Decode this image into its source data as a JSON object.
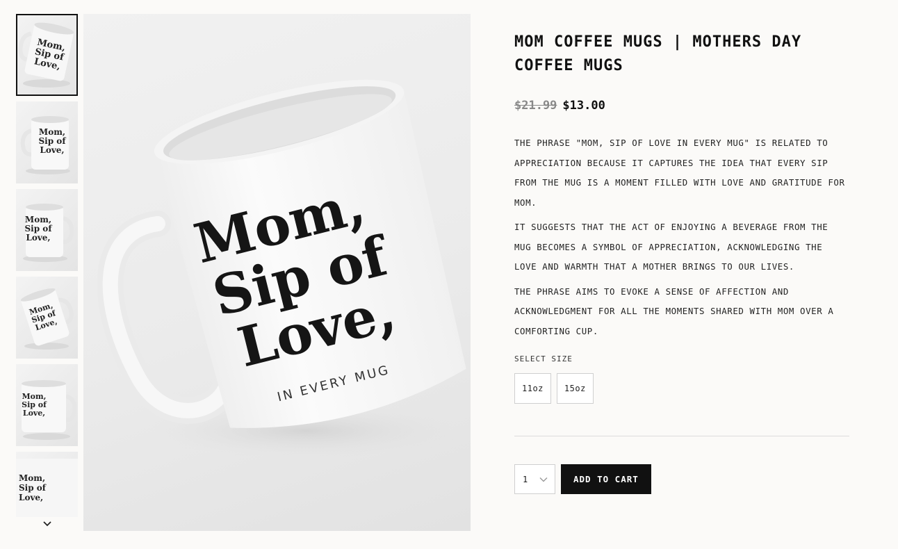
{
  "product": {
    "title": "Mom Coffee Mugs | Mothers Day Coffee Mugs",
    "price_original": "$21.99",
    "price_sale": "$13.00",
    "description": [
      "The phrase \"Mom, Sip of Love in Every Mug\" is related to appreciation because it captures the idea that every sip from the mug is a moment filled with love and gratitude for Mom.",
      "It suggests that the act of enjoying a beverage from the mug becomes a symbol of appreciation, acknowledging the love and warmth that a mother brings to our lives.",
      "The phrase aims to evoke a sense of affection and acknowledgment for all the moments shared with Mom over a comforting cup."
    ]
  },
  "mug_print": {
    "line1": "Mom,",
    "line2": "Sip of",
    "line3": "Love,",
    "tagline": "IN EVERY MUG"
  },
  "gallery": {
    "selected_index": 0,
    "thumbnail_count": 6,
    "scroll_icon": "chevron-down-icon"
  },
  "size_selector": {
    "label": "Select Size",
    "options": [
      "11oz",
      "15oz"
    ]
  },
  "cart": {
    "quantity": "1",
    "quantity_icon": "chevron-down-icon",
    "add_label": "Add to cart"
  },
  "colors": {
    "background": "#fbfaf8",
    "button": "#111111",
    "old_price": "#888888"
  }
}
